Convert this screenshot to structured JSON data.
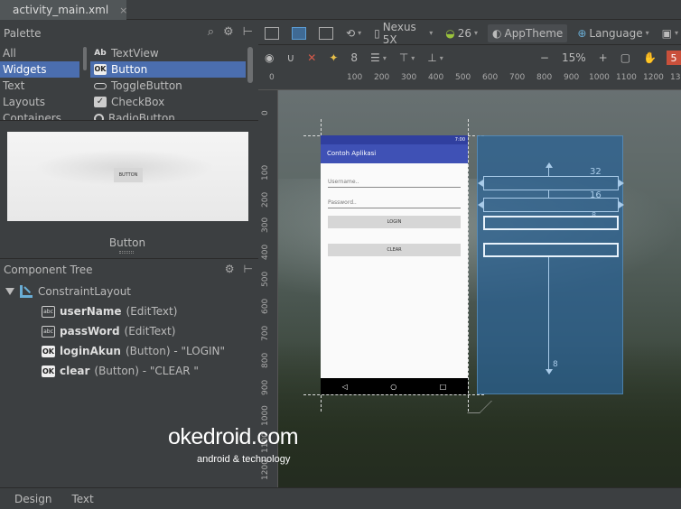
{
  "file_tab": {
    "label": "activity_main.xml",
    "close": "×"
  },
  "palette": {
    "title": "Palette",
    "categories": [
      "All",
      "Widgets",
      "Text",
      "Layouts",
      "Containers"
    ],
    "selected_category": "Widgets",
    "widgets": [
      {
        "label": "TextView",
        "icon": "Ab"
      },
      {
        "label": "Button",
        "icon": "OK"
      },
      {
        "label": "ToggleButton",
        "icon": ""
      },
      {
        "label": "CheckBox",
        "icon": "✓"
      },
      {
        "label": "RadioButton",
        "icon": ""
      }
    ],
    "selected_widget": "Button"
  },
  "preview": {
    "button_text": "BUTTON",
    "label": "Button"
  },
  "component_tree": {
    "title": "Component Tree",
    "root": "ConstraintLayout",
    "items": [
      {
        "icon": "abc",
        "name": "userName",
        "type": "(EditText)"
      },
      {
        "icon": "abc",
        "name": "passWord",
        "type": "(EditText)"
      },
      {
        "icon": "OK",
        "name": "loginAkun",
        "type": "(Button) - \"LOGIN\""
      },
      {
        "icon": "OK",
        "name": "clear",
        "type": "(Button) - \"CLEAR \""
      }
    ]
  },
  "toolbar": {
    "device": "Nexus 5X",
    "api": "26",
    "theme": "AppTheme",
    "language": "Language",
    "margin": "8",
    "zoom": "15%",
    "error_count": "5",
    "minus": "−",
    "plus": "+"
  },
  "ruler": {
    "top": [
      "0",
      "100",
      "200",
      "300",
      "400",
      "500",
      "600",
      "700",
      "800",
      "900",
      "1000",
      "1100",
      "1200",
      "13"
    ],
    "left": [
      "0",
      "100",
      "200",
      "300",
      "400",
      "500",
      "600",
      "700",
      "800",
      "900",
      "1000",
      "1100",
      "1200",
      "1300"
    ]
  },
  "phone": {
    "status_time": "7:00",
    "app_title": "Contoh Aplikasi",
    "username_hint": "Username..",
    "password_hint": "Password..",
    "login_label": "LOGIN",
    "clear_label": "CLEAR",
    "nav_back": "◁",
    "nav_home": "○",
    "nav_recent": "□"
  },
  "blueprint": {
    "margin_top": "32",
    "margin_mid": "16",
    "margin_small": "8",
    "margin_bottom": "8"
  },
  "bottom_tabs": [
    "Design",
    "Text"
  ],
  "watermark": {
    "main": "okedroid.com",
    "sub": "android & technology"
  },
  "colors": {
    "selection": "#4b6eaf",
    "app_bar": "#3f51b5",
    "status_bar": "#303f9f",
    "blueprint": "#296296",
    "error": "#c9503b"
  }
}
